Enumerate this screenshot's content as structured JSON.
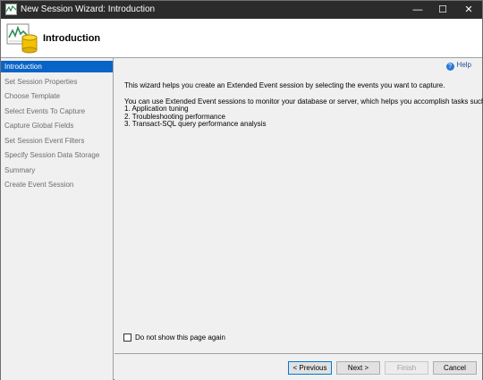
{
  "window": {
    "title": "New Session Wizard: Introduction",
    "controls": {
      "minimize": "—",
      "maximize": "☐",
      "close": "✕"
    }
  },
  "header": {
    "heading": "Introduction"
  },
  "sidebar": {
    "items": [
      {
        "label": "Introduction",
        "active": true
      },
      {
        "label": "Set Session Properties"
      },
      {
        "label": "Choose Template"
      },
      {
        "label": "Select Events To Capture"
      },
      {
        "label": "Capture Global Fields"
      },
      {
        "label": "Set Session Event Filters"
      },
      {
        "label": "Specify Session Data Storage"
      },
      {
        "label": "Summary"
      },
      {
        "label": "Create Event Session"
      }
    ]
  },
  "main": {
    "help_label": "Help",
    "intro_text": "This wizard helps you create an Extended Event session by selecting the events you want to capture.",
    "tasks_intro": "You can use Extended Event sessions to monitor your database or server, which helps you accomplish tasks such as:",
    "tasks": [
      "1. Application tuning",
      "2. Troubleshooting performance",
      "3. Transact-SQL query performance analysis"
    ],
    "checkbox_label": "Do not show this page again",
    "checkbox_checked": false
  },
  "footer": {
    "previous": "< Previous",
    "next": "Next >",
    "finish": "Finish",
    "cancel": "Cancel"
  }
}
